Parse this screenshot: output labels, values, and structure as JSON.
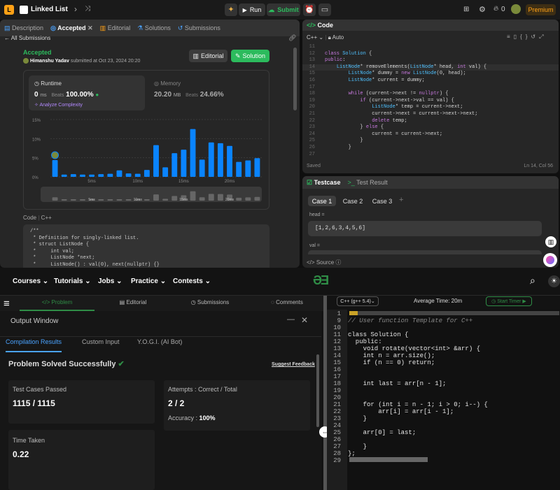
{
  "leetcode": {
    "title": "Linked List",
    "run_label": "Run",
    "submit_label": "Submit",
    "streak": "0",
    "premium_label": "Premium",
    "tabs": [
      {
        "label": "Description"
      },
      {
        "label": "Accepted"
      },
      {
        "label": "Editorial"
      },
      {
        "label": "Solutions"
      },
      {
        "label": "Submissions"
      }
    ],
    "all_submissions": "All Submissions",
    "status": "Accepted",
    "user": "Himanshu Yadav",
    "submitted_at": "submitted at Oct 23, 2024 20:20",
    "editorial_btn": "Editorial",
    "solution_btn": "Solution",
    "runtime": {
      "label": "Runtime",
      "value": "0",
      "unit": "ms",
      "beats_label": "Beats",
      "beats": "100.00%"
    },
    "analyze_label": "Analyze Complexity",
    "memory": {
      "label": "Memory",
      "value": "20.20",
      "unit": "MB",
      "beats_label": "Beats",
      "beats": "24.66%"
    },
    "code_label": "Code",
    "code_lang": "C++",
    "snippet": [
      "/**",
      " * Definition for singly-linked list.",
      " * struct ListNode {",
      " *     int val;",
      " *     ListNode *next;",
      " *     ListNode() : val(0), next(nullptr) {}"
    ],
    "editor": {
      "tab": "Code",
      "lang": "C++",
      "mode": "Auto",
      "saved": "Saved",
      "cursor": "Ln 14, Col 56",
      "lines": [
        {
          "n": "11",
          "t": ""
        },
        {
          "n": "12",
          "t": "class Solution {"
        },
        {
          "n": "13",
          "t": "public:"
        },
        {
          "n": "14",
          "t": "    ListNode* removeElements(ListNode* head, int val) {"
        },
        {
          "n": "15",
          "t": "        ListNode* dummy = new ListNode(0, head);"
        },
        {
          "n": "16",
          "t": "        ListNode* current = dummy;"
        },
        {
          "n": "17",
          "t": ""
        },
        {
          "n": "18",
          "t": "        while (current->next != nullptr) {"
        },
        {
          "n": "19",
          "t": "            if (current->next->val == val) {"
        },
        {
          "n": "20",
          "t": "                ListNode* temp = current->next;"
        },
        {
          "n": "21",
          "t": "                current->next = current->next->next;"
        },
        {
          "n": "22",
          "t": "                delete temp;"
        },
        {
          "n": "23",
          "t": "            } else {"
        },
        {
          "n": "24",
          "t": "                current = current->next;"
        },
        {
          "n": "25",
          "t": "            }"
        },
        {
          "n": "26",
          "t": "        }"
        },
        {
          "n": "27",
          "t": ""
        },
        {
          "n": "28",
          "t": "        ListNode* newHead = dummy->next;"
        }
      ]
    },
    "testcase": {
      "tab": "Testcase",
      "result_tab": "Test Result",
      "cases": [
        "Case 1",
        "Case 2",
        "Case 3"
      ],
      "head_label": "head =",
      "head_value": "[1,2,6,3,4,5,6]",
      "val_label": "val =",
      "source_label": "Source"
    }
  },
  "chart_data": {
    "type": "bar",
    "title": "",
    "xlabel": "",
    "ylabel": "",
    "y_ticks": [
      "15%",
      "10%",
      "5%",
      "0%"
    ],
    "ylim": [
      0,
      15
    ],
    "x_ticks": [
      "5ms",
      "10ms",
      "15ms",
      "20ms"
    ],
    "mini_ticks": [
      "5ms",
      "10ms",
      "15ms",
      "20ms"
    ],
    "values": [
      4.4,
      0.6,
      0.7,
      0.6,
      0.6,
      0.7,
      0.8,
      1.7,
      0.9,
      0.8,
      1.8,
      8.3,
      2.5,
      6.2,
      7.1,
      12.5,
      4.5,
      9.0,
      8.8,
      8.1,
      3.9,
      4.3,
      4.9
    ],
    "highlight_index": 0,
    "grid": true
  },
  "gfg": {
    "nav": [
      "Courses",
      "Tutorials",
      "Jobs",
      "Practice",
      "Contests"
    ],
    "tabs": [
      "Problem",
      "Editorial",
      "Submissions",
      "Comments"
    ],
    "output_window": "Output Window",
    "subtabs": [
      "Compilation Results",
      "Custom Input",
      "Y.O.G.I. (AI Bot)"
    ],
    "solved_msg": "Problem Solved Successfully",
    "feedback": "Suggest Feedback",
    "tests_label": "Test Cases Passed",
    "tests_value": "1115 / 1115",
    "attempts_label": "Attempts : Correct / Total",
    "attempts_value": "2 / 2",
    "accuracy_label": "Accuracy :",
    "accuracy_value": "100%",
    "time_label": "Time Taken",
    "time_value": "0.22",
    "lang": "C++ (g++ 5.4)",
    "avg_time": "Average Time: 20m",
    "start_timer": "Start Timer",
    "code": [
      {
        "n": "1",
        "t": ""
      },
      {
        "n": "9",
        "t": "// User function Template for C++"
      },
      {
        "n": "10",
        "t": ""
      },
      {
        "n": "11",
        "t": "class Solution {"
      },
      {
        "n": "12",
        "t": "  public:"
      },
      {
        "n": "13",
        "t": "    void rotate(vector<int> &arr) {"
      },
      {
        "n": "14",
        "t": "    int n = arr.size();"
      },
      {
        "n": "15",
        "t": "    if (n == 0) return;"
      },
      {
        "n": "16",
        "t": ""
      },
      {
        "n": "17",
        "t": ""
      },
      {
        "n": "18",
        "t": "    int last = arr[n - 1];"
      },
      {
        "n": "19",
        "t": ""
      },
      {
        "n": "20",
        "t": ""
      },
      {
        "n": "21",
        "t": "    for (int i = n - 1; i > 0; i--) {"
      },
      {
        "n": "22",
        "t": "        arr[i] = arr[i - 1];"
      },
      {
        "n": "23",
        "t": "    }"
      },
      {
        "n": "24",
        "t": ""
      },
      {
        "n": "25",
        "t": "    arr[0] = last;"
      },
      {
        "n": "26",
        "t": ""
      },
      {
        "n": "27",
        "t": "    }"
      },
      {
        "n": "28",
        "t": "};"
      },
      {
        "n": "29",
        "t": ""
      }
    ]
  },
  "colors": {
    "accent_green": "#2cbb5d",
    "bar_blue": "#0a84ff",
    "gfg_green": "#2f8d46",
    "premium": "#ffa116"
  }
}
